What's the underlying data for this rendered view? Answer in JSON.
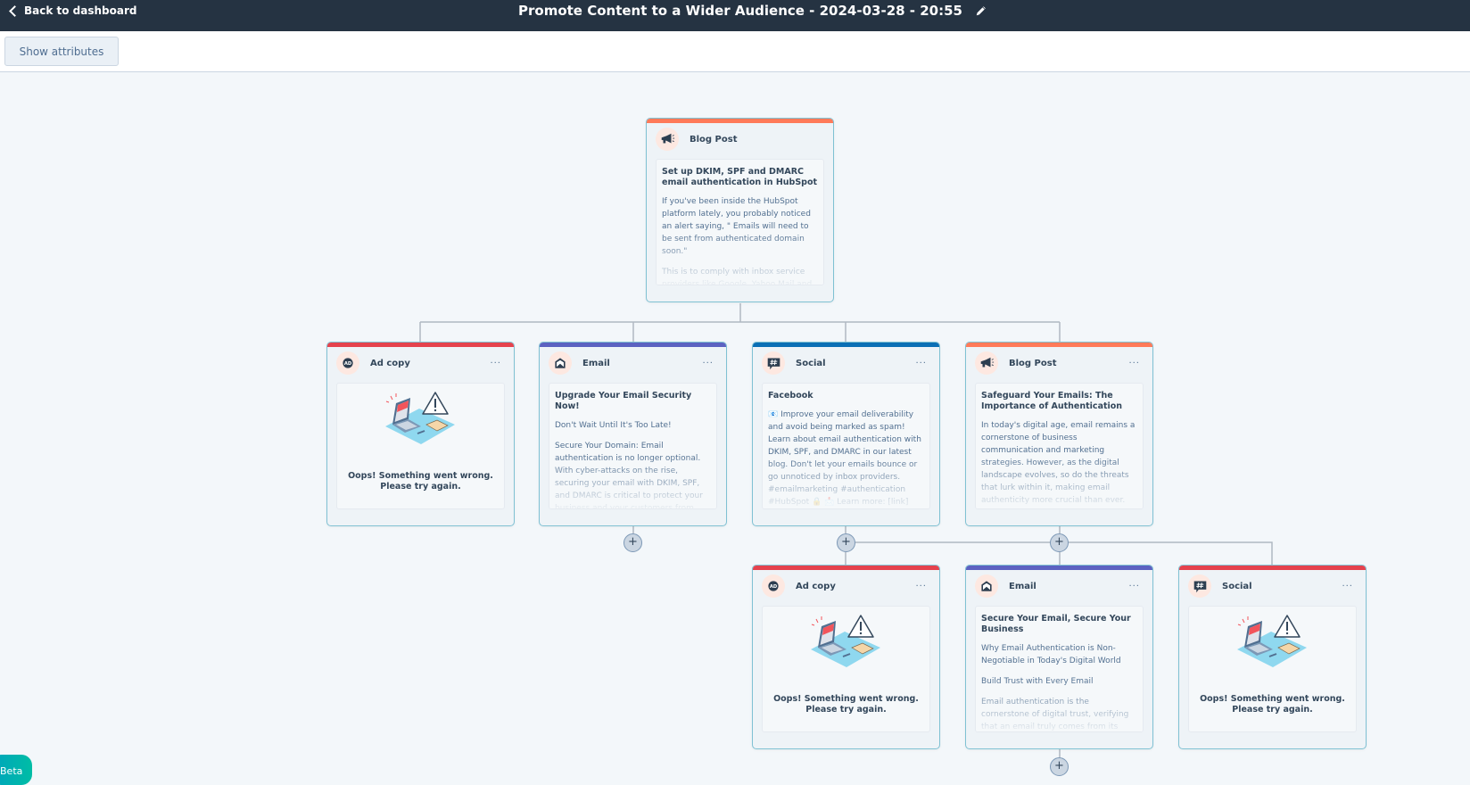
{
  "header": {
    "back_label": "Back to dashboard",
    "title": "Promote Content to a Wider Audience - 2024-03-28 - 20:55"
  },
  "toolbar": {
    "show_attributes_label": "Show attributes"
  },
  "colors": {
    "header_bg": "#253342",
    "blog_post": "#ff7a59",
    "ad_copy": "#e5424d",
    "email": "#5c62c1",
    "social": "#0b6fb5",
    "social_error": "#e5424d",
    "card_border": "#7fc1d3"
  },
  "error_message": "Oops! Something went wrong. Please try again.",
  "menu_glyph": "···",
  "plus_glyph": "+",
  "beta_label": "Beta",
  "cards": {
    "root": {
      "type": "Blog Post",
      "icon": "megaphone-icon",
      "title": "Set up DKIM, SPF and DMARC email authentication in HubSpot",
      "paragraphs": [
        "If you've been inside the HubSpot platform lately, you probably noticed an alert saying, \" Emails will need to be sent from authenticated domain soon.\"",
        "This is to comply with inbox service providers like Google, Yahoo Mail and"
      ]
    },
    "ad1": {
      "type": "Ad copy",
      "icon": "ad-icon"
    },
    "email1": {
      "type": "Email",
      "icon": "envelope-icon",
      "title": "Upgrade Your Email Security Now!",
      "paragraphs": [
        "Don't Wait Until It's Too Late!",
        "Secure Your Domain: Email authentication is no longer optional. With cyber-attacks on the rise, securing your email with DKIM, SPF, and DMARC is critical to protect your business and your customers from phishing and spoofing. Authentication"
      ]
    },
    "social1": {
      "type": "Social",
      "icon": "hashtag-chat-icon",
      "title": "Facebook",
      "paragraphs": [
        "📧 Improve your email deliverability and avoid being marked as spam! Learn about email authentication with DKIM, SPF, and DMARC in our latest blog. Don't let your emails bounce or go unnoticed by inbox providers. #emailmarketing #authentication #HubSpot 🔒 📩 Learn more: [link]"
      ]
    },
    "blog2": {
      "type": "Blog Post",
      "icon": "megaphone-icon",
      "title": "Safeguard Your Emails: The Importance of Authentication",
      "paragraphs": [
        "In today's digital age, email remains a cornerstone of business communication and marketing strategies. However, as the digital landscape evolves, so do the threats that lurk within it, making email authenticity more crucial than ever. Email authentication"
      ]
    },
    "ad2": {
      "type": "Ad copy",
      "icon": "ad-icon"
    },
    "email2": {
      "type": "Email",
      "icon": "envelope-icon",
      "title": "Secure Your Email, Secure Your Business",
      "paragraphs": [
        "Why Email Authentication is Non-Negotiable in Today's Digital World",
        "Build Trust with Every Email",
        "Email authentication is the cornerstone of digital trust, verifying that an email truly comes from its claimed source. In"
      ]
    },
    "social2": {
      "type": "Social",
      "icon": "hashtag-chat-icon"
    }
  }
}
